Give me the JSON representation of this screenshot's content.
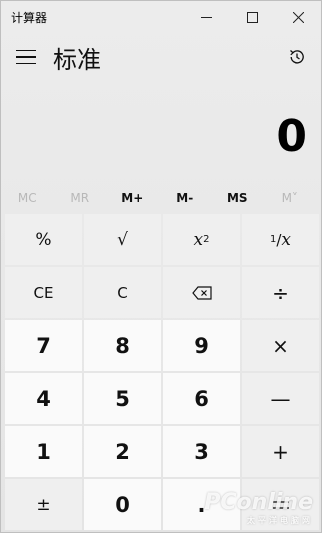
{
  "window": {
    "title": "计算器",
    "minimize_label": "–",
    "maximize_label": "□",
    "close_label": "✕"
  },
  "header": {
    "mode_title": "标准",
    "history_icon": "history-icon"
  },
  "display": {
    "value": "0"
  },
  "memory": [
    {
      "label": "MC",
      "enabled": false
    },
    {
      "label": "MR",
      "enabled": false
    },
    {
      "label": "M+",
      "enabled": true
    },
    {
      "label": "M-",
      "enabled": true
    },
    {
      "label": "MS",
      "enabled": true
    },
    {
      "label": "M˅",
      "enabled": false
    }
  ],
  "keys": {
    "percent": "%",
    "sqrt": "√",
    "square_base": "x",
    "square_exp": "2",
    "reciprocal_num": "1",
    "reciprocal_den": "x",
    "ce": "CE",
    "c": "C",
    "backspace_icon": "backspace-icon",
    "divide": "÷",
    "seven": "7",
    "eight": "8",
    "nine": "9",
    "multiply": "×",
    "four": "4",
    "five": "5",
    "six": "6",
    "minus": "—",
    "one": "1",
    "two": "2",
    "three": "3",
    "plus": "+",
    "negate": "±",
    "zero": "0",
    "decimal": "."
  },
  "watermark": {
    "brand": "PConline",
    "subtitle": "太平洋电脑网"
  }
}
